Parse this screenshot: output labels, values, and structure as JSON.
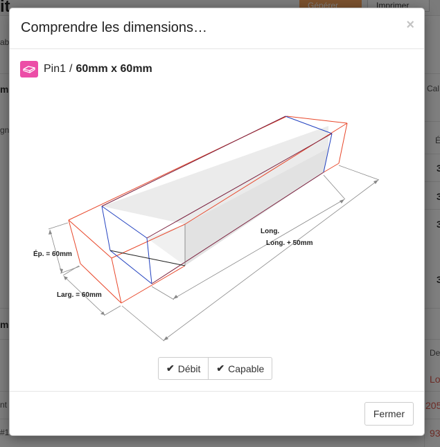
{
  "background": {
    "title_fragment": "it",
    "orange_button_label": "Générer",
    "print_button_label": "Imprimer",
    "fragments": [
      "ab",
      "m",
      "Cal",
      "gn",
      "É",
      "3",
      "3",
      "3",
      "3",
      "m",
      "De",
      "Lo",
      "nt",
      "205",
      "#1",
      "93"
    ]
  },
  "modal": {
    "title": "Comprendre les dimensions…",
    "close_symbol": "×",
    "part": {
      "icon": "part-icon",
      "name": "Pin1",
      "separator": "/",
      "dimensions": "60mm x 60mm"
    },
    "diagram": {
      "labels": {
        "thickness": "Ép. = 60mm",
        "width": "Larg. = 60mm",
        "length": "Long.",
        "length_plus": "Long. + 50mm"
      },
      "colors": {
        "rough_outline": "#e8472a",
        "finished_outline": "#1f3fbf",
        "face_light": "#ececec",
        "face_dark": "#e0e0e0",
        "dimension_line": "#888888"
      }
    },
    "toggle_buttons": [
      {
        "label": "Débit",
        "icon": "checkmark-icon"
      },
      {
        "label": "Capable",
        "icon": "checkmark-icon"
      }
    ],
    "footer": {
      "close_button_label": "Fermer"
    }
  }
}
